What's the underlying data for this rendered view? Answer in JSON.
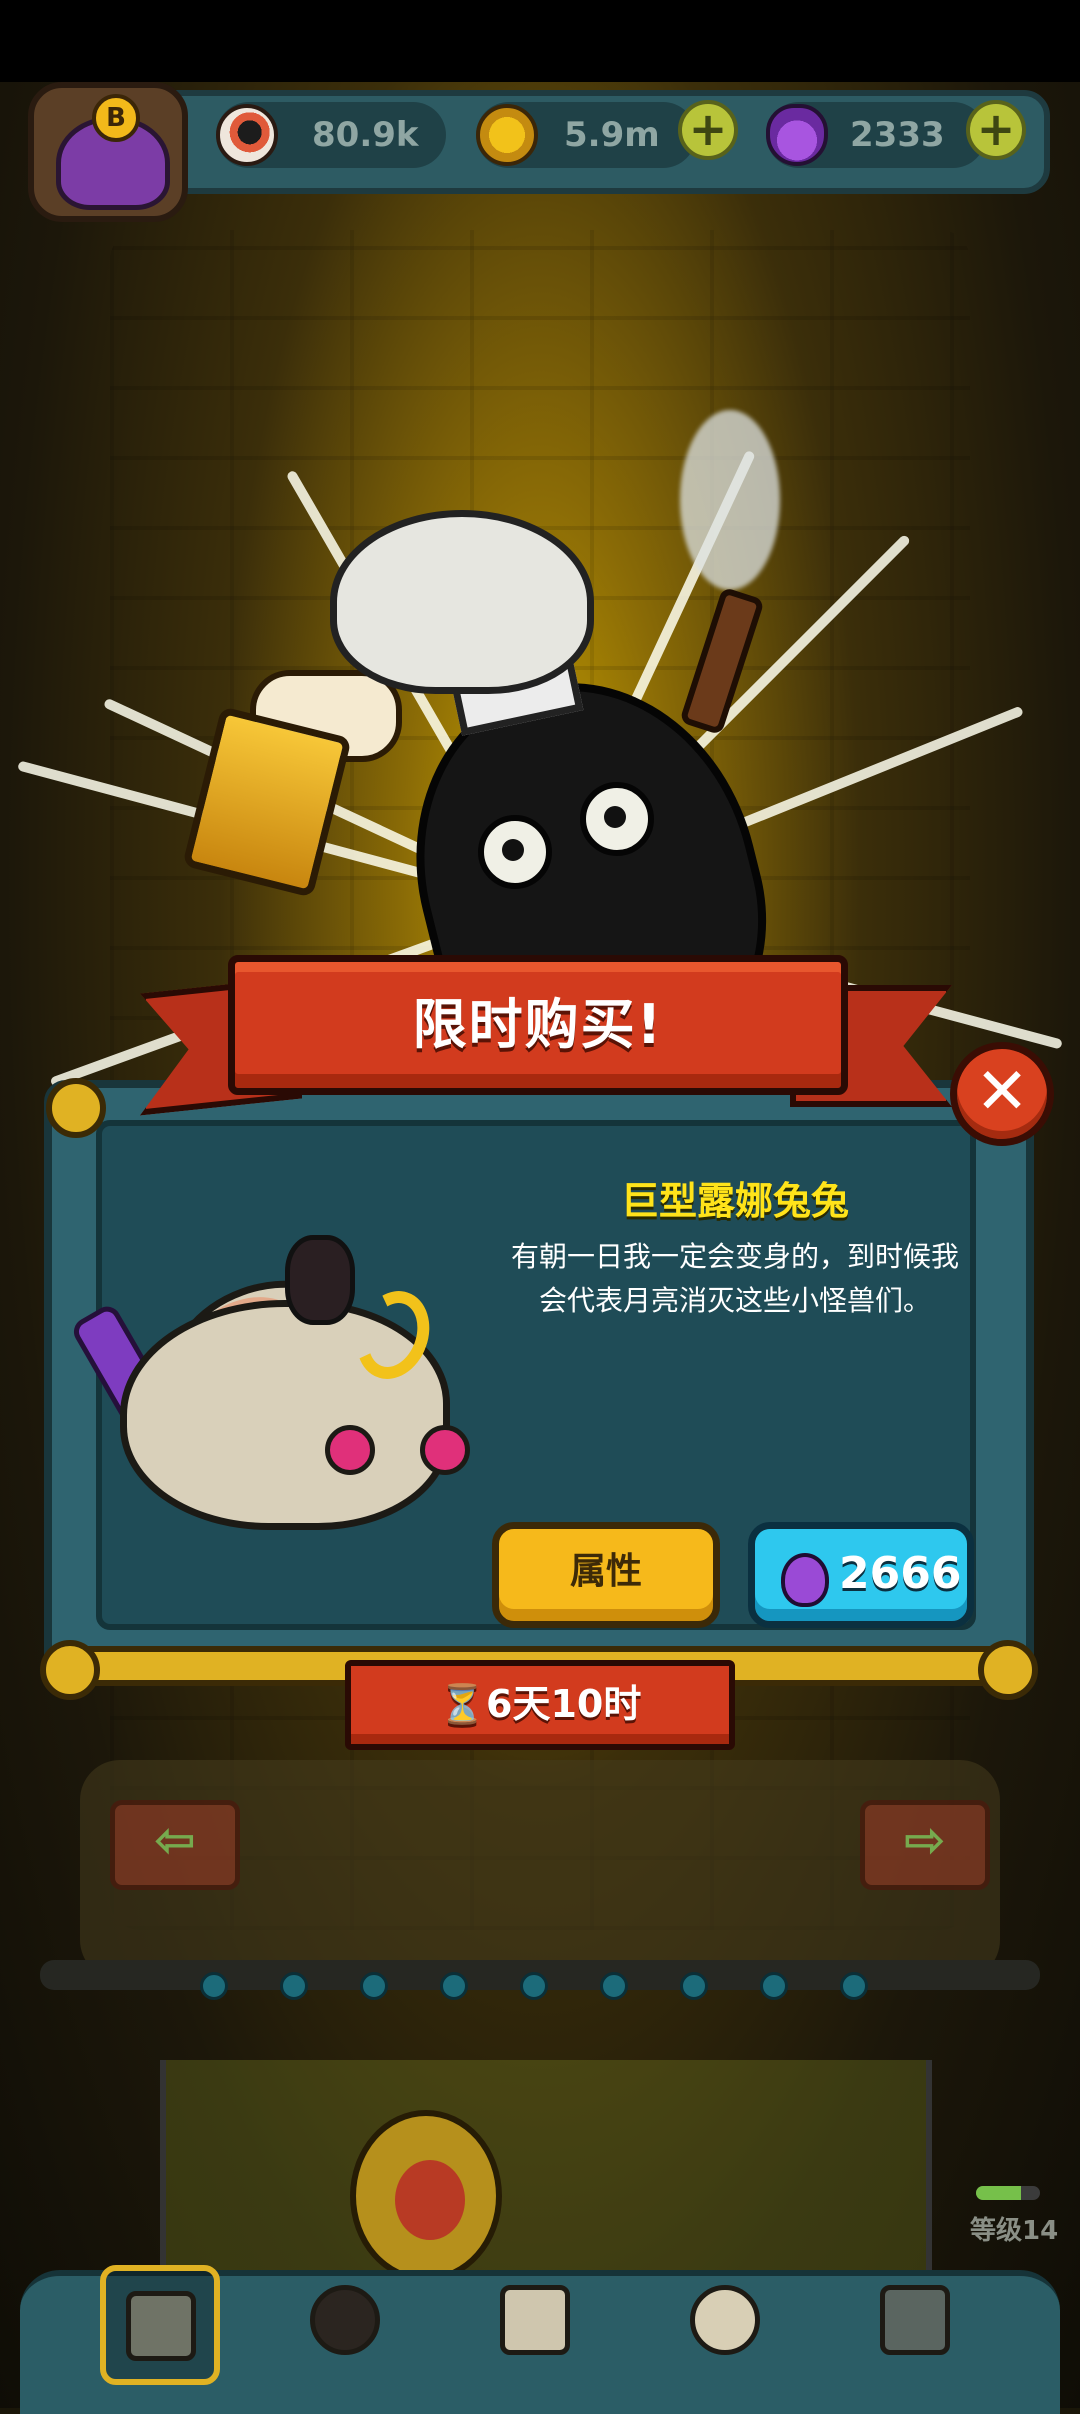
{
  "hud": {
    "resources": [
      {
        "icon": "eyeball-icon",
        "value": "80.9k"
      },
      {
        "icon": "gold-coin-icon",
        "value": "5.9m"
      },
      {
        "icon": "potion-icon",
        "value": "2333"
      }
    ]
  },
  "offer": {
    "title": "限时购买!",
    "item_name": "巨型露娜兔兔",
    "description_line1": "有朝一日我一定会变身的，到时候我",
    "description_line2": "会代表月亮消灭这些小怪兽们。",
    "attributes_label": "属性",
    "price": "2666",
    "price_icon": "potion-icon",
    "timer": "6天10时",
    "timer_icon": "hourglass-icon",
    "close_label": "✕"
  },
  "player": {
    "level_label": "等级14",
    "level_progress": 0.7
  },
  "colors": {
    "banner_red": "#d23b1e",
    "item_name_yellow": "#ffe31a",
    "attr_button": "#f6b91b",
    "buy_button": "#2ec8ee",
    "panel_teal": "#1f4c57"
  }
}
